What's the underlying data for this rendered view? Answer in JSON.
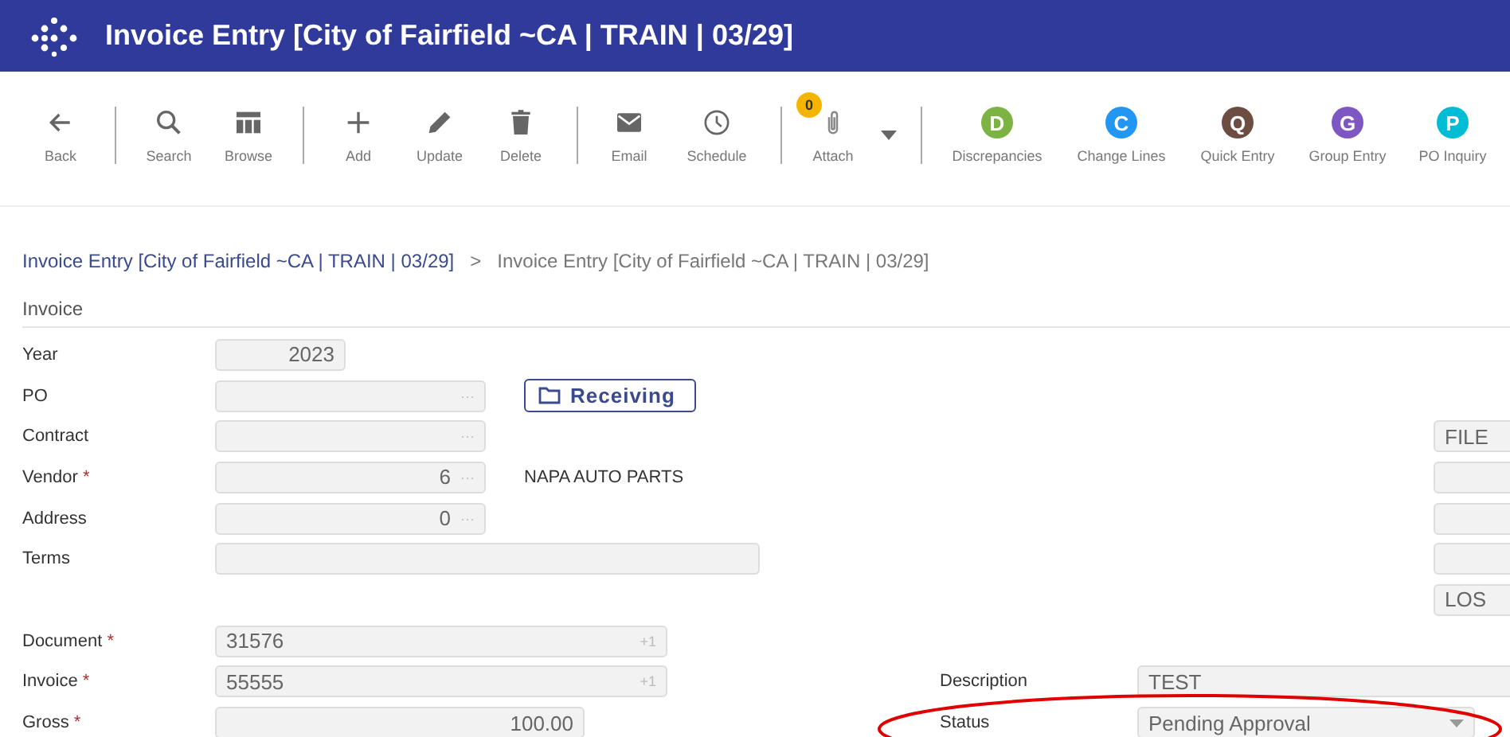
{
  "window": {
    "title": "Invoice Entry [City of Fairfield ~CA | TRAIN | 03/29]"
  },
  "toolbar": [
    {
      "kind": "button",
      "label": "Back"
    },
    {
      "kind": "separator"
    },
    {
      "kind": "button",
      "label": "Search"
    },
    {
      "kind": "button",
      "label": "Browse"
    },
    {
      "kind": "separator"
    },
    {
      "kind": "button",
      "label": "Add"
    },
    {
      "kind": "button",
      "label": "Update"
    },
    {
      "kind": "button",
      "label": "Delete"
    },
    {
      "kind": "separator"
    },
    {
      "kind": "button",
      "label": "Email"
    },
    {
      "kind": "button",
      "label": "Schedule"
    },
    {
      "kind": "separator"
    },
    {
      "kind": "button",
      "label": "Attach",
      "badge": "0"
    },
    {
      "kind": "dropdown"
    },
    {
      "kind": "separator"
    },
    {
      "kind": "letter",
      "letter": "D",
      "label": "Discrepancies",
      "color": "#7cb342"
    },
    {
      "kind": "letter",
      "letter": "C",
      "label": "Change Lines",
      "color": "#2196f3"
    },
    {
      "kind": "letter",
      "letter": "Q",
      "label": "Quick Entry",
      "color": "#6d4c41"
    },
    {
      "kind": "letter",
      "letter": "G",
      "label": "Group Entry",
      "color": "#7e57c2"
    },
    {
      "kind": "letter",
      "letter": "P",
      "label": "PO Inquiry",
      "color": "#00bcd4"
    }
  ],
  "breadcrumb": [
    {
      "label": "Invoice Entry [City of Fairfield ~CA | TRAIN | 03/29]",
      "link": true
    },
    {
      "label": ">",
      "link": false
    },
    {
      "label": "Invoice Entry [City of Fairfield ~CA | TRAIN | 03/29]",
      "link": false
    }
  ],
  "section": {
    "title": "Invoice"
  },
  "fields": [
    {
      "label": "Year",
      "kind": "year",
      "value": "2023"
    },
    {
      "label": "PO",
      "kind": "lookup",
      "suffix": "···",
      "button": "Receiving"
    },
    {
      "label": "Contract",
      "kind": "lookup",
      "suffix": "···"
    },
    {
      "label": "Vendor",
      "required_mark": "*",
      "kind": "lookup",
      "value": "6",
      "suffix": "···",
      "note": "NAPA AUTO PARTS"
    },
    {
      "label": "Address",
      "kind": "lookup",
      "value": "0",
      "suffix": "···"
    },
    {
      "label": "Terms",
      "kind": "wide"
    },
    {
      "label": "Document",
      "required_mark": "*",
      "kind": "document",
      "value": "31576",
      "suffix": "+1"
    },
    {
      "label": "Invoice",
      "required_mark": "*",
      "kind": "document",
      "value": "55555",
      "suffix": "+1"
    },
    {
      "label": "Gross",
      "required_mark": "*",
      "kind": "amount",
      "value": "100.00"
    }
  ],
  "side_fields": [
    {
      "kind": "text",
      "value": "FILE"
    },
    {
      "kind": "blank"
    },
    {
      "kind": "blank"
    },
    {
      "kind": "blank"
    },
    {
      "kind": "text",
      "value": "LOS"
    }
  ],
  "details": [
    {
      "label": "Description",
      "kind": "text",
      "value": "TEST"
    },
    {
      "label": "Status",
      "kind": "select",
      "value": "Pending Approval",
      "highlighted": true
    }
  ]
}
